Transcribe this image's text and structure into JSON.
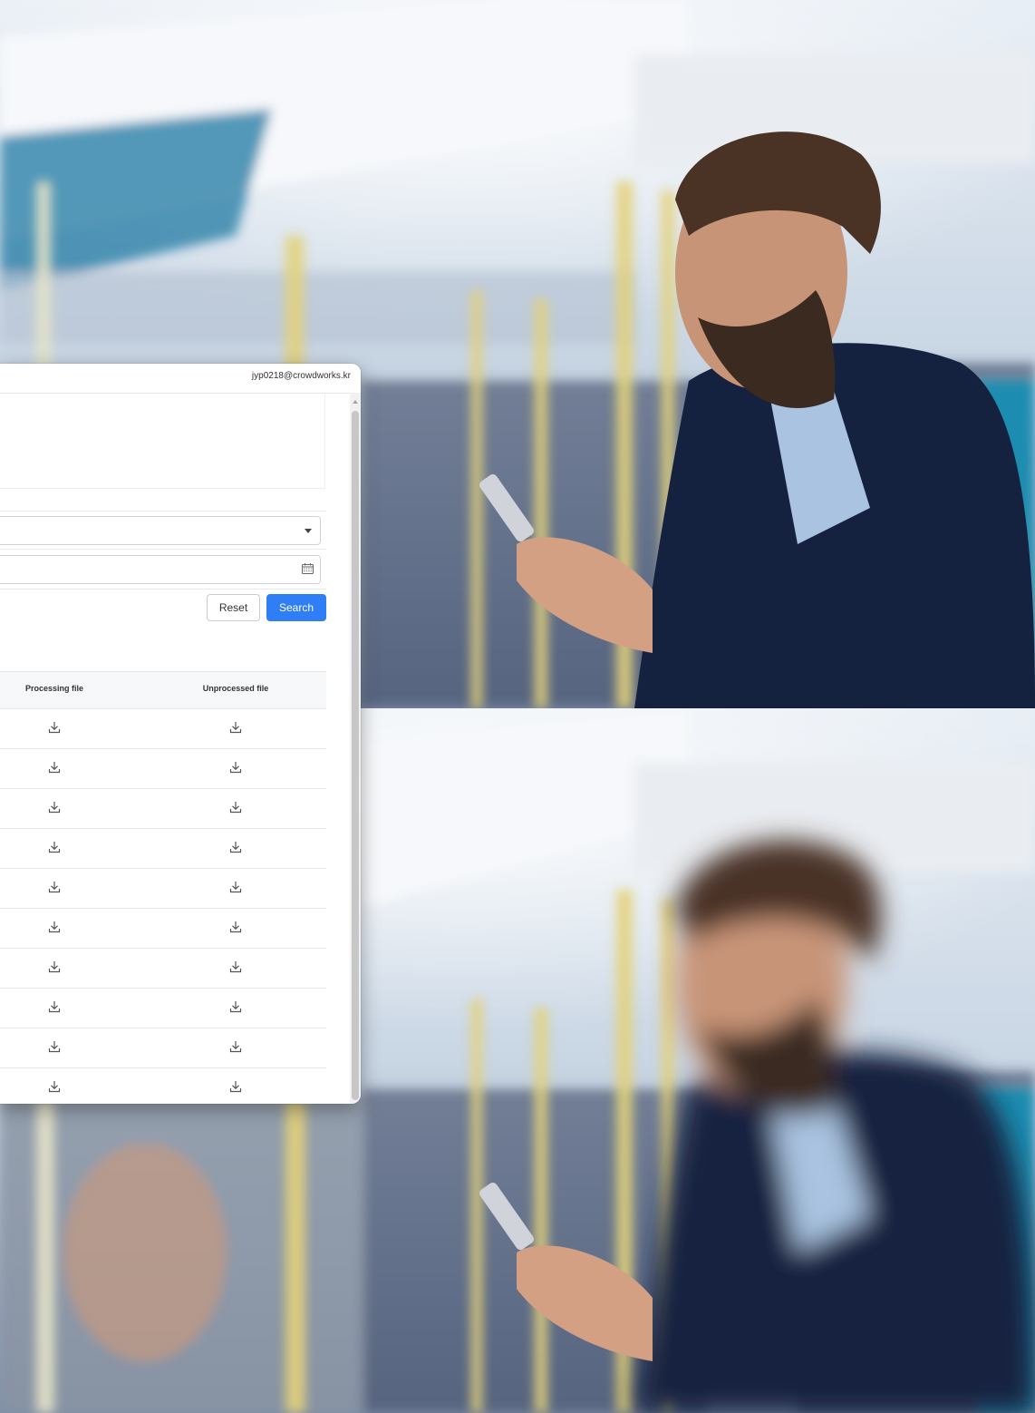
{
  "header": {
    "user_email": "jyp0218@crowdworks.kr"
  },
  "filters": {
    "reset_label": "Reset",
    "search_label": "Search"
  },
  "table": {
    "columns": [
      "Processing file",
      "Unprocessed file"
    ],
    "row_count": 10
  },
  "icons": {
    "download": "download-icon",
    "calendar": "calendar-icon",
    "dropdown": "chevron-down-icon"
  },
  "colors": {
    "primary": "#2f7ef6",
    "jacket": "#14213f",
    "seat_accent": "#1e8db0",
    "pole": "#e3d27a"
  }
}
